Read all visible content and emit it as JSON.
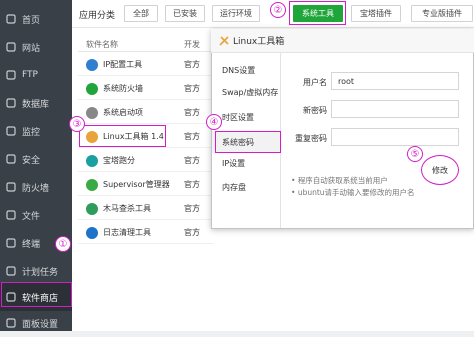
{
  "sidebar": {
    "items": [
      {
        "label": "首页",
        "icon": "home-icon"
      },
      {
        "label": "网站",
        "icon": "globe-icon"
      },
      {
        "label": "FTP",
        "icon": "ftp-icon"
      },
      {
        "label": "数据库",
        "icon": "database-icon"
      },
      {
        "label": "监控",
        "icon": "monitor-icon"
      },
      {
        "label": "安全",
        "icon": "shield-icon"
      },
      {
        "label": "防火墙",
        "icon": "firewall-icon"
      },
      {
        "label": "文件",
        "icon": "folder-icon"
      },
      {
        "label": "终端",
        "icon": "terminal-icon"
      },
      {
        "label": "计划任务",
        "icon": "clock-icon"
      },
      {
        "label": "软件商店",
        "icon": "grid-icon"
      },
      {
        "label": "面板设置",
        "icon": "gear-icon"
      }
    ],
    "active_index": 10
  },
  "filter": {
    "label": "应用分类",
    "tabs": [
      "全部",
      "已安装",
      "运行环境",
      "系统工具",
      "宝塔插件",
      "专业版插件"
    ],
    "active_index": 3
  },
  "table": {
    "headers": [
      "软件名称",
      "开发"
    ],
    "rows": [
      {
        "name": "IP配置工具",
        "dev": "官方",
        "icon_color": "#2f7fd1"
      },
      {
        "name": "系统防火墙",
        "dev": "官方",
        "icon_color": "#20a53a"
      },
      {
        "name": "系统启动项",
        "dev": "官方",
        "icon_color": "#888888"
      },
      {
        "name": "Linux工具箱 1.4",
        "dev": "官方",
        "icon_color": "#e8a33d"
      },
      {
        "name": "宝塔跑分",
        "dev": "官方",
        "icon_color": "#1aa0a0"
      },
      {
        "name": "Supervisor管理器",
        "dev": "官方",
        "icon_color": "#3aaa45"
      },
      {
        "name": "木马查杀工具",
        "dev": "官方",
        "icon_color": "#2e9c5a"
      },
      {
        "name": "日志清理工具",
        "dev": "官方",
        "icon_color": "#1e73c8"
      }
    ]
  },
  "modal": {
    "title": "Linux工具箱",
    "side_items": [
      "DNS设置",
      "Swap/虚拟内存",
      "时区设置",
      "系统密码",
      "IP设置",
      "内存盘"
    ],
    "active_side_index": 3,
    "fields": [
      {
        "label": "用户名",
        "value": "root",
        "placeholder": ""
      },
      {
        "label": "新密码",
        "value": "",
        "placeholder": ""
      },
      {
        "label": "重复密码",
        "value": "",
        "placeholder": ""
      }
    ],
    "submit_label": "修改",
    "hints": [
      "程序自动获取系统当前用户",
      "ubuntu请手动输入要修改的用户名"
    ]
  },
  "annotations": [
    "①",
    "②",
    "③",
    "④",
    "⑤"
  ],
  "colors": {
    "accent": "#20a53a",
    "sidebar": "#3a4047",
    "marker": "#d21ec8"
  }
}
